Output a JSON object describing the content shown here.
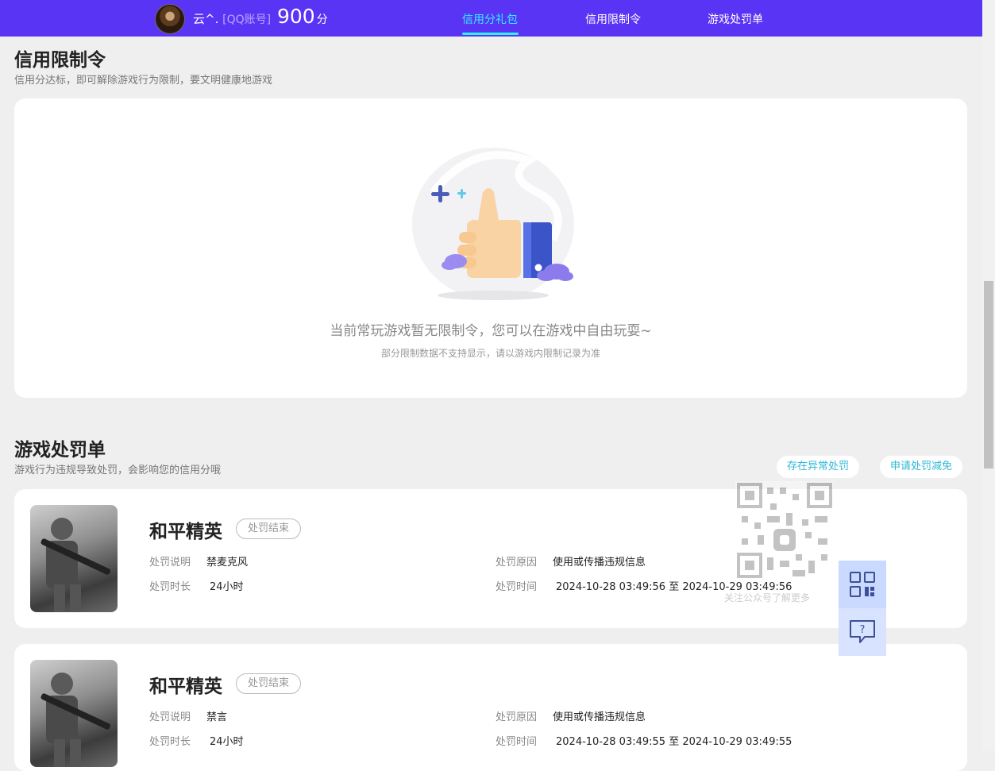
{
  "header": {
    "username": "云^.",
    "account_type": "[QQ账号]",
    "score": "900",
    "score_unit": "分",
    "nav": [
      "信用分礼包",
      "信用限制令",
      "游戏处罚单"
    ],
    "active_nav": "信用分礼包"
  },
  "restriction": {
    "title": "信用限制令",
    "subtitle": "信用分达标，即可解除游戏行为限制，要文明健康地游戏",
    "empty_main": "当前常玩游戏暂无限制令，您可以在游戏中自由玩耍~",
    "empty_sub": "部分限制数据不支持显示，请以游戏内限制记录为准"
  },
  "penalty": {
    "title": "游戏处罚单",
    "subtitle": "游戏行为违规导致处罚，会影响您的信用分哦",
    "actions": [
      "存在异常处罚",
      "申请处罚减免"
    ],
    "labels": {
      "desc": "处罚说明",
      "duration": "处罚时长",
      "reason": "处罚原因",
      "time": "处罚时间"
    },
    "records": [
      {
        "game": "和平精英",
        "status": "处罚结束",
        "desc": "禁麦克风",
        "duration": "24小时",
        "reason": "使用或传播违规信息",
        "time": "2024-10-28 03:49:56 至 2024-10-29 03:49:56"
      },
      {
        "game": "和平精英",
        "status": "处罚结束",
        "desc": "禁言",
        "duration": "24小时",
        "reason": "使用或传播违规信息",
        "time": "2024-10-28 03:49:55 至 2024-10-29 03:49:55"
      }
    ]
  },
  "float": {
    "qr_caption": "关注公众号了解更多",
    "icons": [
      "qrcode-icon",
      "feedback-icon"
    ]
  },
  "colors": {
    "header_bg": "#5a34f5",
    "accent": "#2ff0ff",
    "pill_text": "#2eb8d6"
  }
}
